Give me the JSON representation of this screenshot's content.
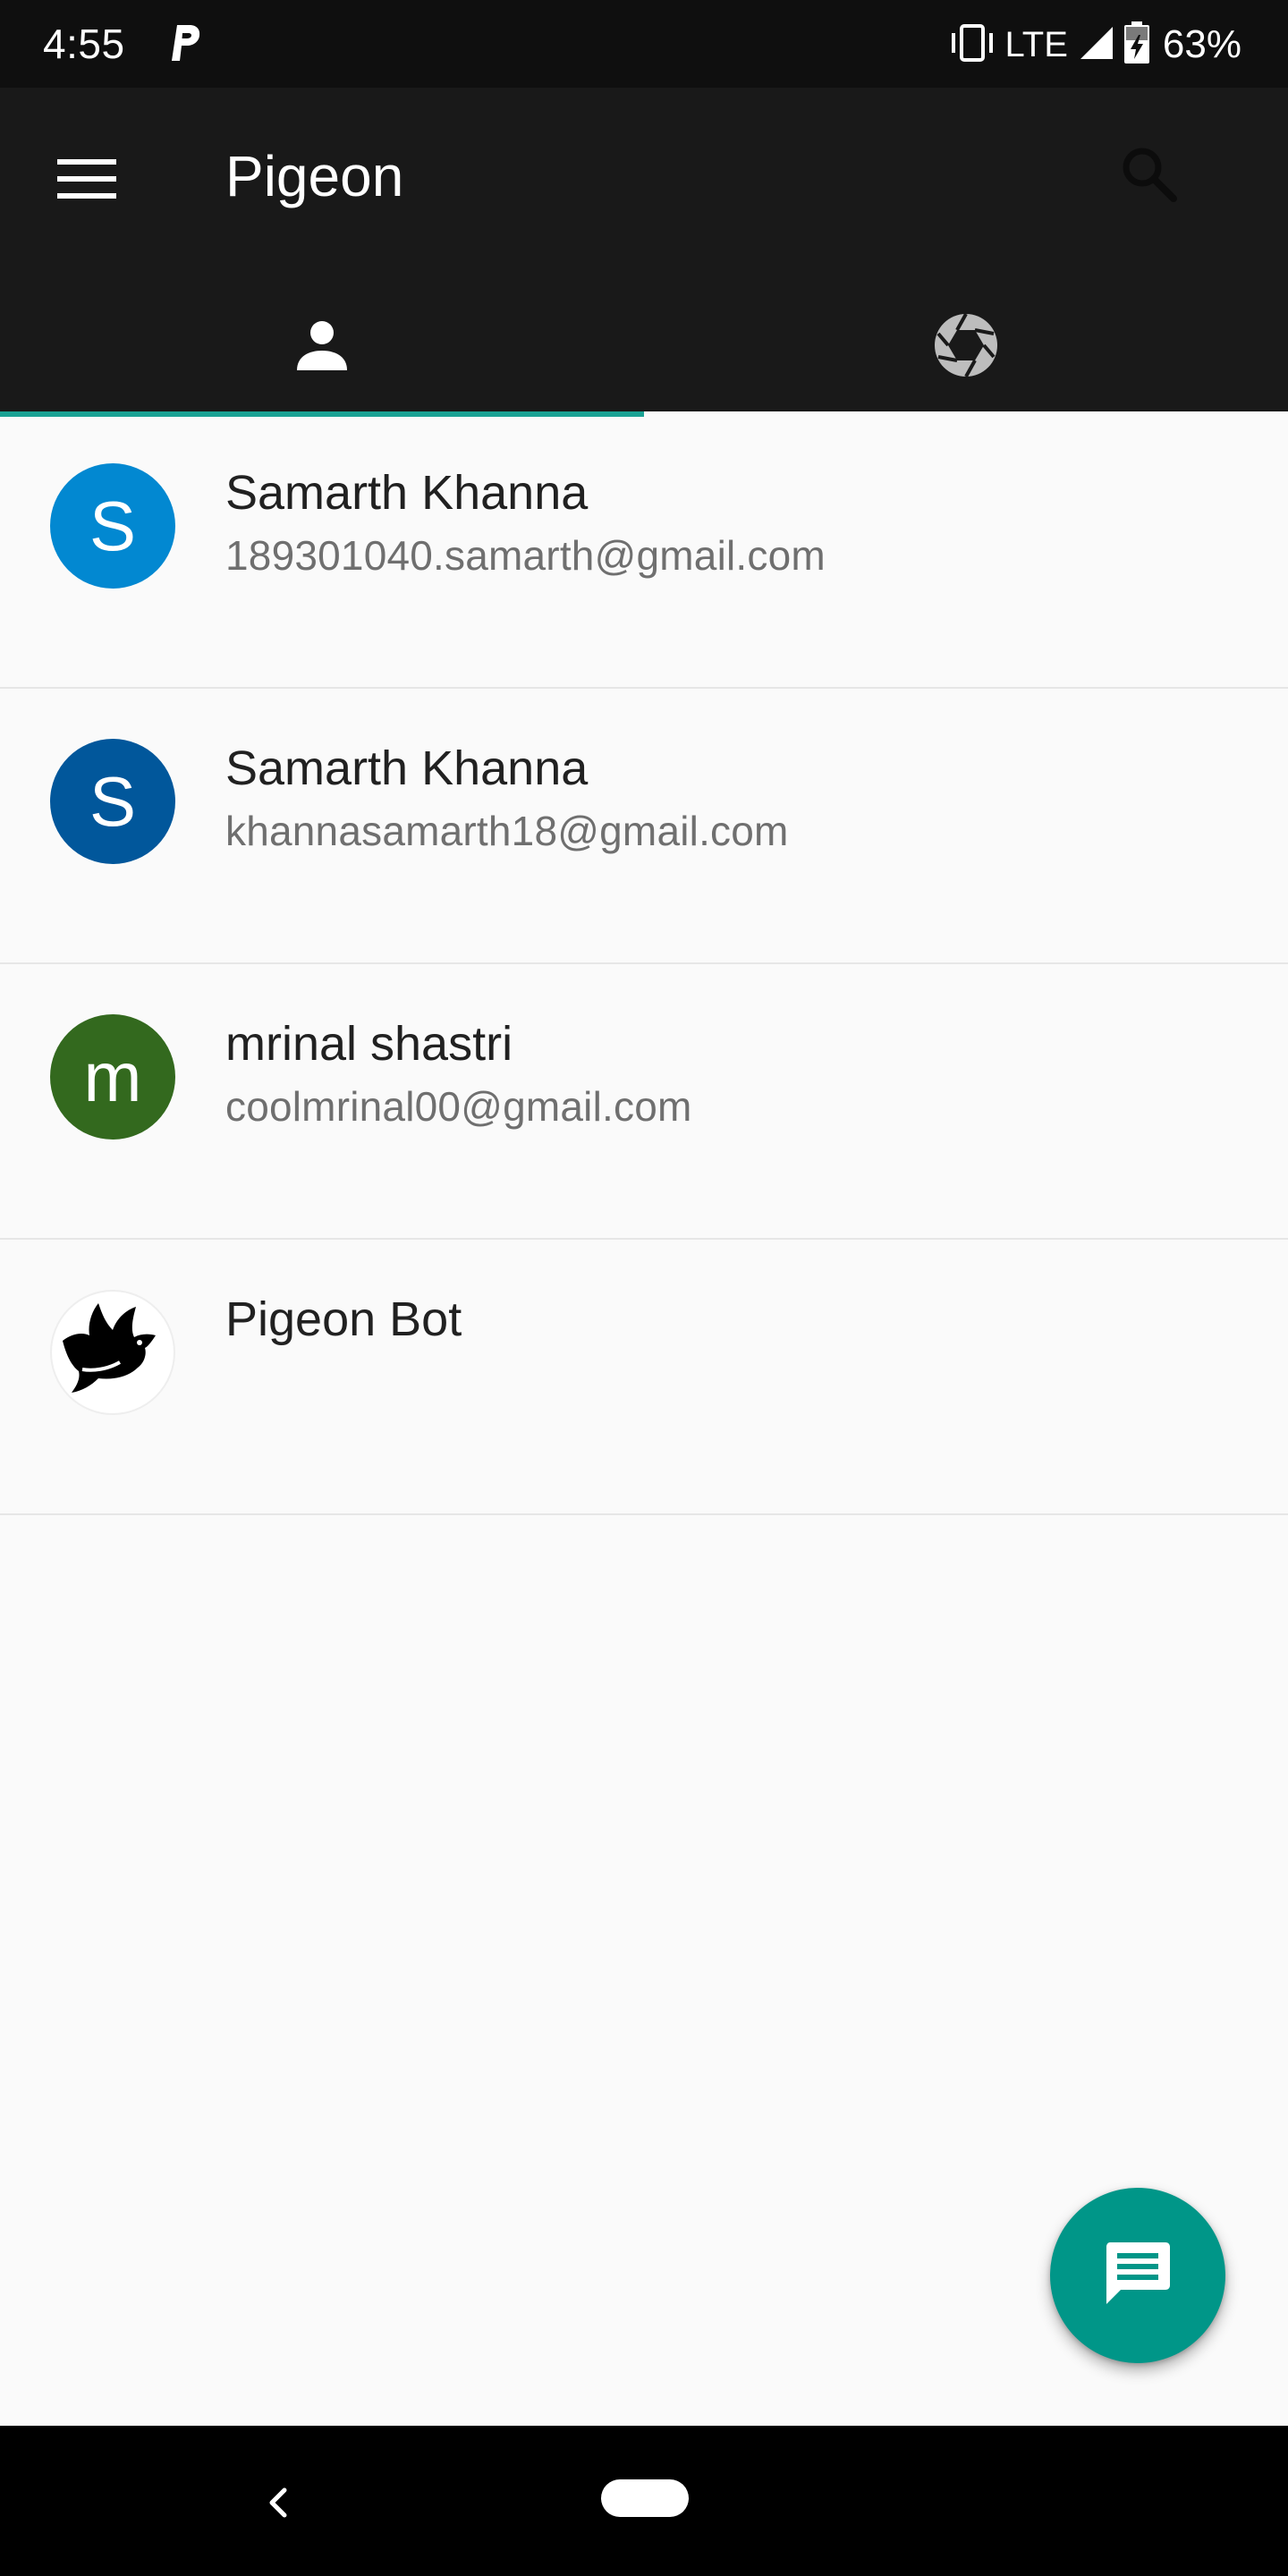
{
  "status_bar": {
    "time": "4:55",
    "network": "LTE",
    "battery": "63%",
    "icons": [
      "p-icon",
      "vibrate-icon",
      "signal-icon",
      "battery-charging-icon"
    ]
  },
  "app_bar": {
    "title": "Pigeon",
    "icons": [
      "menu-icon",
      "search-icon"
    ]
  },
  "tabs": [
    {
      "icon": "person-icon",
      "selected": true
    },
    {
      "icon": "camera-aperture-icon",
      "selected": false
    }
  ],
  "contacts": [
    {
      "initial": "S",
      "name": "Samarth Khanna",
      "email": "189301040.samarth@gmail.com",
      "color": "#0288d1"
    },
    {
      "initial": "S",
      "name": "Samarth Khanna",
      "email": "khannasamarth18@gmail.com",
      "color": "#01579b"
    },
    {
      "initial": "m",
      "name": "mrinal shastri",
      "email": "coolmrinal00@gmail.com",
      "color": "#33691e"
    },
    {
      "initial": "",
      "name": "Pigeon Bot",
      "email": "",
      "color": "#ffffff",
      "icon": "pigeon-logo-icon"
    }
  ],
  "fab": {
    "icon": "chat-icon",
    "color": "#009688"
  },
  "nav_bar": {
    "icons": [
      "back-icon",
      "home-pill-icon"
    ]
  },
  "colors": {
    "accent": "#1aa294",
    "app_bar": "#191919",
    "status_bar": "#0f0f0f",
    "background": "#fafafa"
  }
}
